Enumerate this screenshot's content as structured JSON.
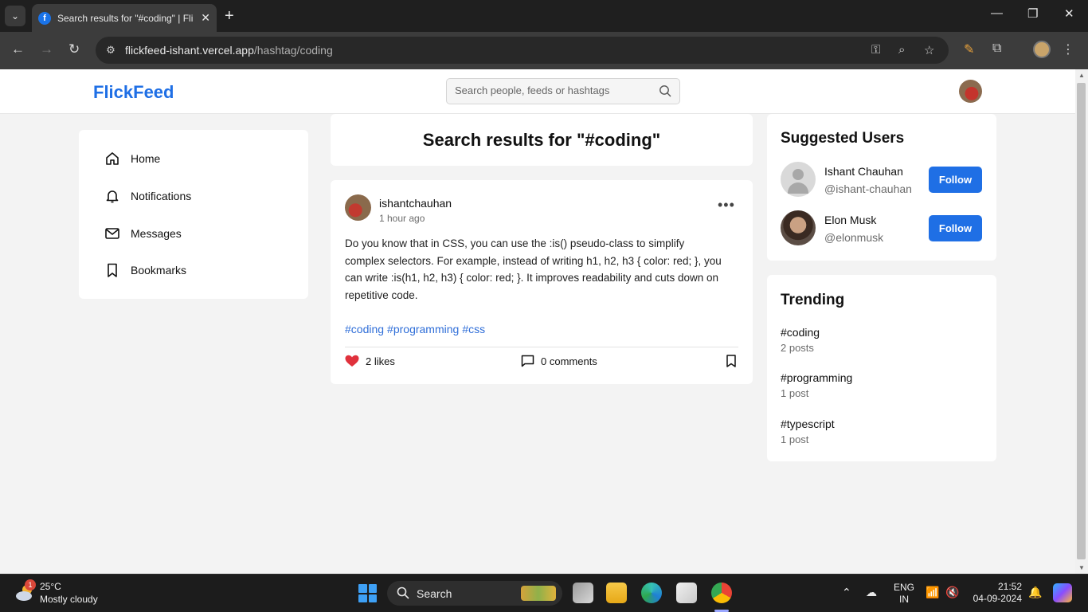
{
  "browser": {
    "tab_title": "Search results for \"#coding\" | FlickFeed",
    "favicon_letter": "f",
    "url_host": "flickfeed-ishant.vercel.app",
    "url_path": "/hashtag/coding"
  },
  "header": {
    "logo": "FlickFeed",
    "search_placeholder": "Search people, feeds or hashtags"
  },
  "sidebar": {
    "items": [
      {
        "label": "Home",
        "icon": "home-icon"
      },
      {
        "label": "Notifications",
        "icon": "bell-icon"
      },
      {
        "label": "Messages",
        "icon": "mail-icon"
      },
      {
        "label": "Bookmarks",
        "icon": "bookmark-icon"
      }
    ]
  },
  "main": {
    "title": "Search results for \"#coding\"",
    "post": {
      "username": "ishantchauhan",
      "time": "1 hour ago",
      "body": "Do you know that in CSS, you can use the :is() pseudo-class to simplify complex selectors. For example, instead of writing h1, h2, h3 { color: red; }, you can write :is(h1, h2, h3) { color: red; }. It improves readability and cuts down on repetitive code.",
      "hashtags": [
        "#coding",
        "#programming",
        "#css"
      ],
      "likes": "2 likes",
      "comments": "0 comments",
      "liked": true
    }
  },
  "suggested": {
    "heading": "Suggested Users",
    "users": [
      {
        "name": "Ishant Chauhan",
        "handle": "@ishant-chauhan",
        "button": "Follow"
      },
      {
        "name": "Elon Musk",
        "handle": "@elonmusk",
        "button": "Follow"
      }
    ]
  },
  "trending": {
    "heading": "Trending",
    "items": [
      {
        "tag": "#coding",
        "count": "2 posts"
      },
      {
        "tag": "#programming",
        "count": "1 post"
      },
      {
        "tag": "#typescript",
        "count": "1 post"
      }
    ]
  },
  "taskbar": {
    "temperature": "25°C",
    "weather": "Mostly cloudy",
    "weather_badge": "1",
    "search_label": "Search",
    "lang_top": "ENG",
    "lang_bottom": "IN",
    "time": "21:52",
    "date": "04-09-2024"
  },
  "colors": {
    "brand": "#1f6fe5",
    "like": "#e0313c",
    "page_bg": "#f3f3f3"
  }
}
